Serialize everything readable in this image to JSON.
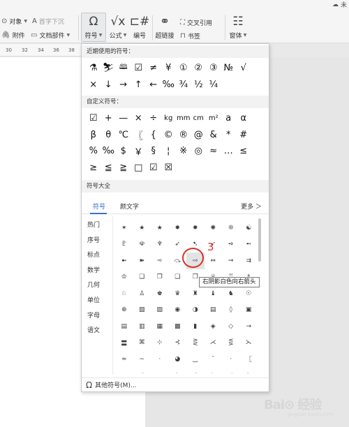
{
  "ribbon": {
    "object_label": "对象",
    "dropcap_label": "首字下沉",
    "attachment_label": "附件",
    "docpart_label": "文档部件",
    "symbol_label": "符号",
    "formula_label": "公式",
    "numbering_label": "编号",
    "hyperlink_label": "超链接",
    "crossref_label": "交叉引用",
    "bookmark_label": "书签",
    "form_label": "窗体",
    "cloud_label": "未"
  },
  "ruler": {
    "ticks": [
      "30",
      "32",
      "34",
      "36",
      "38"
    ]
  },
  "panel": {
    "recent_title": "近期使用的符号：",
    "recent_symbols": [
      "⚗",
      "⛷",
      "🕮",
      "☑",
      "≠",
      "¥",
      "①",
      "②",
      "③",
      "№",
      "√",
      "×",
      "↓",
      "→",
      "↑",
      "←",
      "‰",
      "¾",
      "½",
      "¼"
    ],
    "custom_title": "自定义符号：",
    "custom_symbols": [
      "☑",
      "+",
      "—",
      "×",
      "÷",
      "kg",
      "mm",
      "cm",
      "m²",
      "a",
      "α",
      "β",
      "θ",
      "℃",
      "〖",
      "{",
      "©",
      "®",
      "@",
      "&",
      "*",
      "#",
      "%",
      "‰",
      "$",
      "￥",
      "§",
      "¦",
      "※",
      "◎",
      "≈",
      "…",
      "≤",
      "≥",
      "≦",
      "≧",
      "□",
      "☑",
      "☒"
    ],
    "all_title": "符号大全",
    "tabs": {
      "symbol": "符号",
      "emoticon": "颜文字",
      "more": "更多 ＞"
    },
    "categories": [
      "热门",
      "序号",
      "标点",
      "数学",
      "几何",
      "单位",
      "字母",
      "语文"
    ],
    "big_symbols": [
      "✶",
      "★",
      "★",
      "✸",
      "✹",
      "✺",
      "❊",
      "☯",
      "♇",
      "☫",
      "♆",
      "➶",
      "➷",
      "➹",
      "➺",
      "➻",
      "➼",
      "➽",
      "➾",
      "⤼",
      "⇨",
      "⇔",
      "⇒",
      "⇉",
      "♔",
      "❏",
      "❐",
      "❑",
      "❒",
      "♕",
      "♖",
      "♗",
      "♘",
      "♙",
      "♚",
      "♛",
      "♜",
      "♝",
      "♞",
      "☉",
      "⊕",
      "▧",
      "▨",
      "◉",
      "◑",
      "▤",
      "◊",
      "▣",
      "▤",
      "▥",
      "▦",
      "▩",
      "▮",
      "◈",
      "◇",
      "→",
      "〓",
      "⌘",
      "⊹",
      "⊰",
      "⋛",
      "⋌",
      "⋚",
      "⋋",
      "≈",
      "∼",
      "·",
      "◕",
      "‿",
      "ˉ",
      "·",
      "〖",
      "↘",
      "↗",
      "↙",
      "↖",
      "⇗",
      "⇘",
      "⇙",
      "⇖"
    ],
    "tooltip": "右阴影白色向右箭头",
    "footer_label": "其他符号(M)..."
  },
  "annotation": {
    "number": "3",
    "color": "#d93025"
  },
  "watermark": {
    "main": "Bai⊙ 经验",
    "sub": "jingyan.baidu.com"
  },
  "colors": {
    "accent": "#3b6fc7",
    "panel_header": "#f2f2f2"
  }
}
